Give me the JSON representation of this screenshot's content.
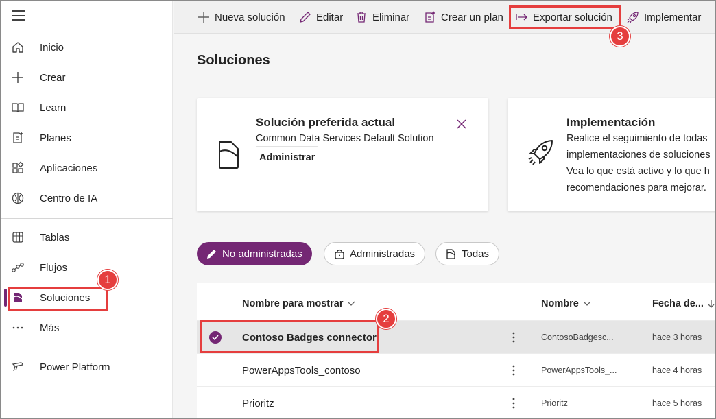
{
  "sidebar": {
    "items": [
      {
        "label": "Inicio",
        "icon": "home-icon"
      },
      {
        "label": "Crear",
        "icon": "plus-icon"
      },
      {
        "label": "Learn",
        "icon": "book-icon"
      },
      {
        "label": "Planes",
        "icon": "plan-icon"
      },
      {
        "label": "Aplicaciones",
        "icon": "apps-icon"
      },
      {
        "label": "Centro de IA",
        "icon": "ai-hub-icon"
      },
      {
        "label": "Tablas",
        "icon": "table-icon"
      },
      {
        "label": "Flujos",
        "icon": "flow-icon"
      },
      {
        "label": "Soluciones",
        "icon": "solutions-icon"
      },
      {
        "label": "Más",
        "icon": "more-icon"
      },
      {
        "label": "Power Platform",
        "icon": "power-platform-icon"
      }
    ],
    "active": "Soluciones"
  },
  "toolbar": {
    "new_solution": "Nueva solución",
    "edit": "Editar",
    "delete": "Eliminar",
    "create_plan": "Crear un plan",
    "export_solution": "Exportar solución",
    "deploy": "Implementar"
  },
  "page": {
    "title": "Soluciones"
  },
  "cards": {
    "preferred": {
      "title": "Solución preferida actual",
      "subtitle": "Common Data Services Default Solution",
      "button": "Administrar"
    },
    "deployment": {
      "title": "Implementación",
      "lines": [
        "Realice el seguimiento de todas",
        "implementaciones de soluciones",
        "Vea lo que está activo y lo que h",
        "recomendaciones para mejorar."
      ]
    }
  },
  "filters": {
    "unmanaged": "No administradas",
    "managed": "Administradas",
    "all": "Todas"
  },
  "grid": {
    "columns": {
      "display_name": "Nombre para mostrar",
      "name": "Nombre",
      "date": "Fecha de..."
    },
    "rows": [
      {
        "display_name": "Contoso Badges connector",
        "name": "ContosoBadgesc...",
        "modified": "hace 3 horas",
        "selected": true
      },
      {
        "display_name": "PowerAppsTools_contoso",
        "name": "PowerAppsTools_...",
        "modified": "hace 4 horas",
        "selected": false
      },
      {
        "display_name": "Prioritz",
        "name": "Prioritz",
        "modified": "hace 5 horas",
        "selected": false
      }
    ]
  },
  "callouts": {
    "one": "1",
    "two": "2",
    "three": "3"
  },
  "colors": {
    "accent": "#742774",
    "callout": "#e53e3e"
  }
}
